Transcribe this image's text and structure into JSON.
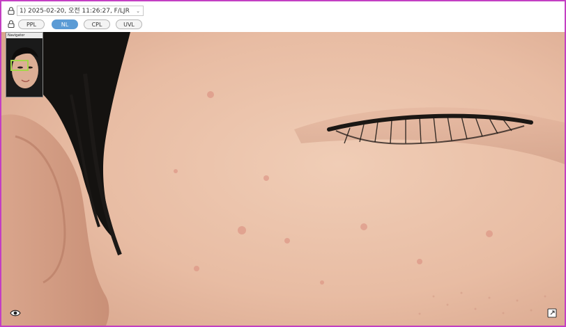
{
  "toolbar": {
    "session_label": "1) 2025-02-20, 오전 11:26:27, F/LJR",
    "lock_icon": "lock-icon",
    "modes": [
      {
        "label": "PPL",
        "active": false
      },
      {
        "label": "NL",
        "active": true
      },
      {
        "label": "CPL",
        "active": false
      },
      {
        "label": "UVL",
        "active": false
      }
    ]
  },
  "navigator": {
    "title": "Navigator"
  },
  "viewer": {
    "view_toggle_icon": "eye-icon",
    "export_icon": "export-icon"
  },
  "colors": {
    "frame_border": "#c33fc3",
    "active_mode": "#5b9bd5",
    "navigator_box": "#a4d64a",
    "skin": "#e9bfa8"
  }
}
